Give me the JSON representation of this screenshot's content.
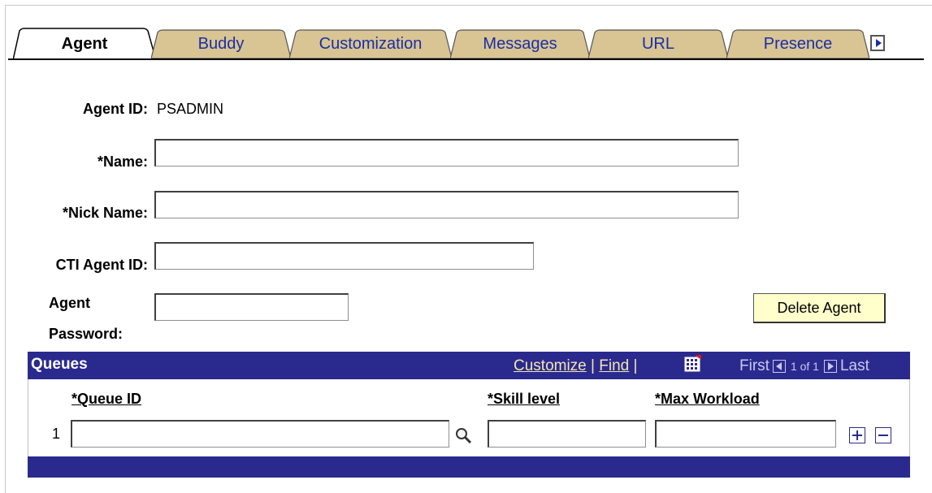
{
  "tabs": [
    {
      "label": "Agent",
      "active": true
    },
    {
      "label": "Buddy",
      "active": false
    },
    {
      "label": "Customization",
      "active": false
    },
    {
      "label": "Messages",
      "active": false
    },
    {
      "label": "URL",
      "active": false
    },
    {
      "label": "Presence",
      "active": false
    }
  ],
  "tab_scroll_icon": "chevron-right-icon",
  "form": {
    "agent_id_label": "Agent ID:",
    "agent_id_value": "PSADMIN",
    "name_label": "*Name:",
    "name_value": "",
    "nick_name_label": "*Nick Name:",
    "nick_name_value": "",
    "cti_agent_id_label": "CTI Agent ID:",
    "cti_agent_id_value": "",
    "agent_password_label_line1": "Agent",
    "agent_password_label_line2": "Password:",
    "agent_password_value": "",
    "delete_button": "Delete Agent"
  },
  "queues_grid": {
    "title": "Queues",
    "customize_link": "Customize",
    "find_link": "Find",
    "separator": "|",
    "first_label": "First",
    "range_label": "1 of 1",
    "last_label": "Last",
    "columns": [
      "*Queue ID",
      "*Skill level",
      "*Max Workload"
    ],
    "rows": [
      {
        "num": "1",
        "queue_id": "",
        "skill_level": "",
        "max_workload": ""
      }
    ]
  },
  "colors": {
    "tab_active": "#ffffff",
    "tab_inactive": "#d9c493",
    "tab_link": "#1a2fa4",
    "grid_header": "#2a2a8e",
    "grid_link": "#f2e6b0",
    "button_bg": "#ffffcc"
  }
}
